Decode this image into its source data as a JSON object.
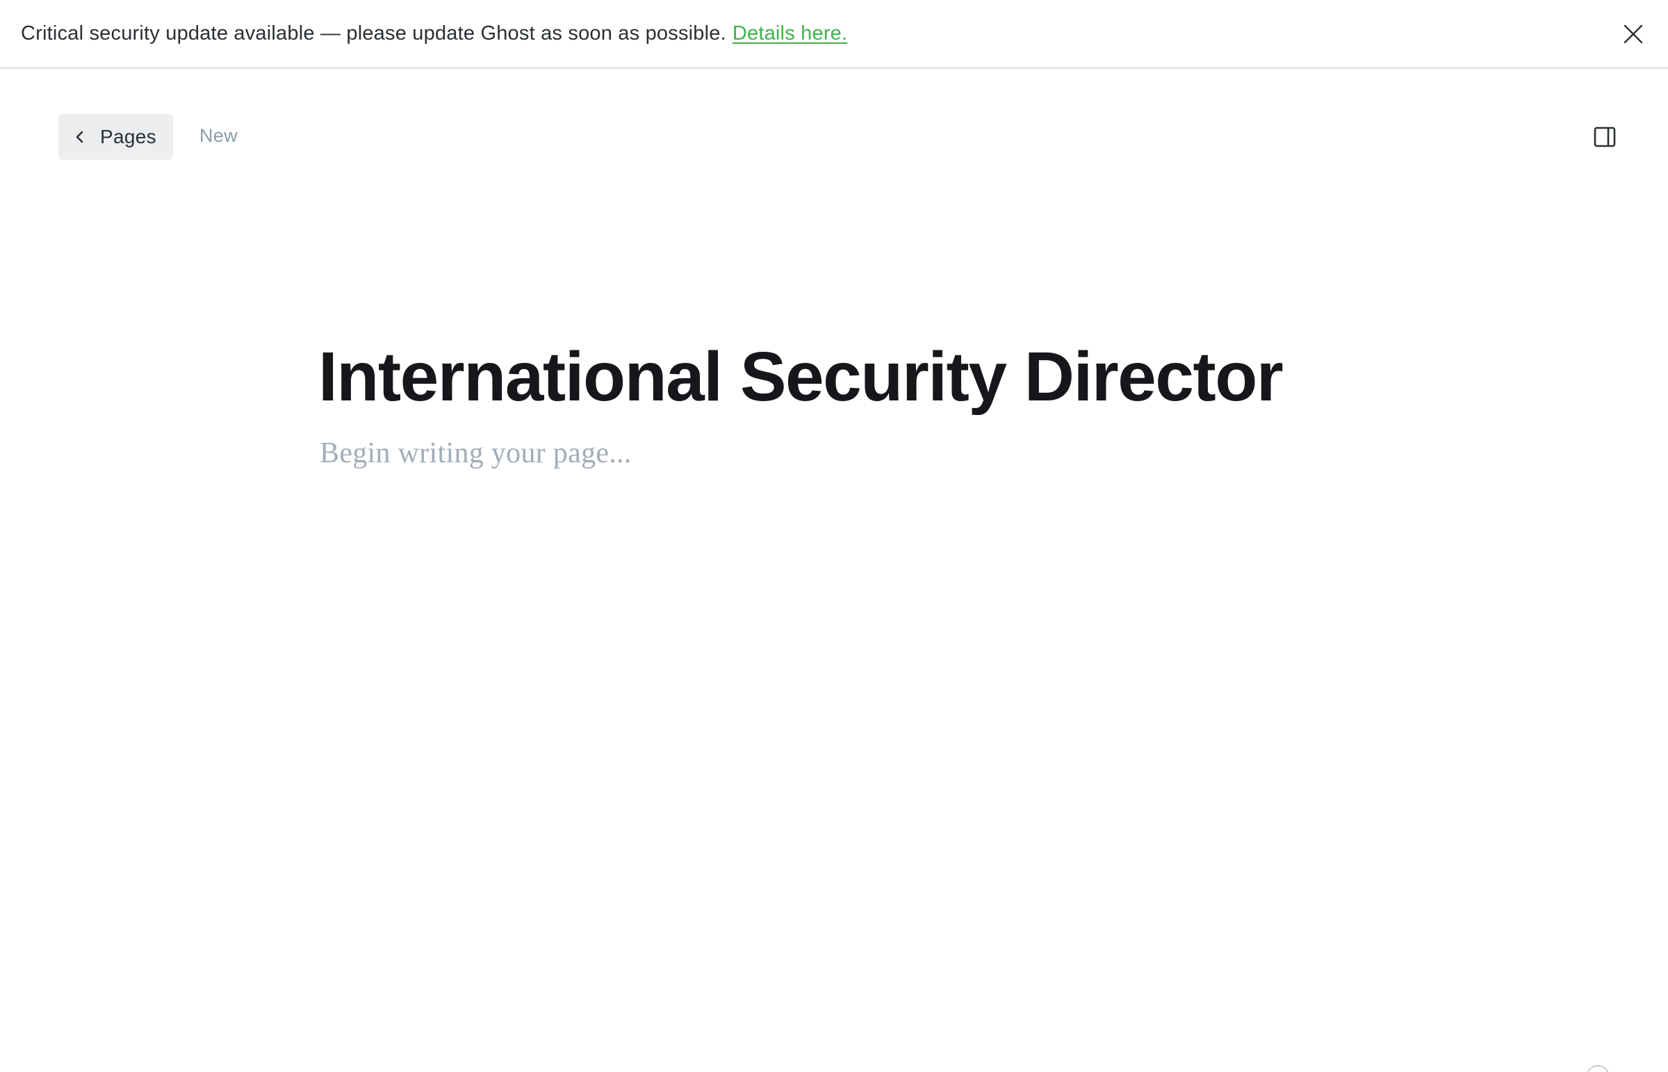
{
  "banner": {
    "message": "Critical security update available — please update Ghost as soon as possible.",
    "link_label": "Details here.",
    "link_color": "#3eb24c",
    "close_icon": "close-icon"
  },
  "topbar": {
    "back_label": "Pages",
    "back_icon": "chevron-left-icon",
    "status": "New",
    "sidebar_icon": "sidebar-toggle-icon"
  },
  "editor": {
    "title": "International Security Director",
    "body_placeholder": "Begin writing your page..."
  },
  "footer": {
    "help_icon": "help-icon"
  },
  "colors": {
    "text": "#15171a",
    "muted": "#8e9aa6",
    "placeholder": "#a3adb8",
    "button_bg": "#eceef0",
    "border": "#dcdfe3"
  }
}
